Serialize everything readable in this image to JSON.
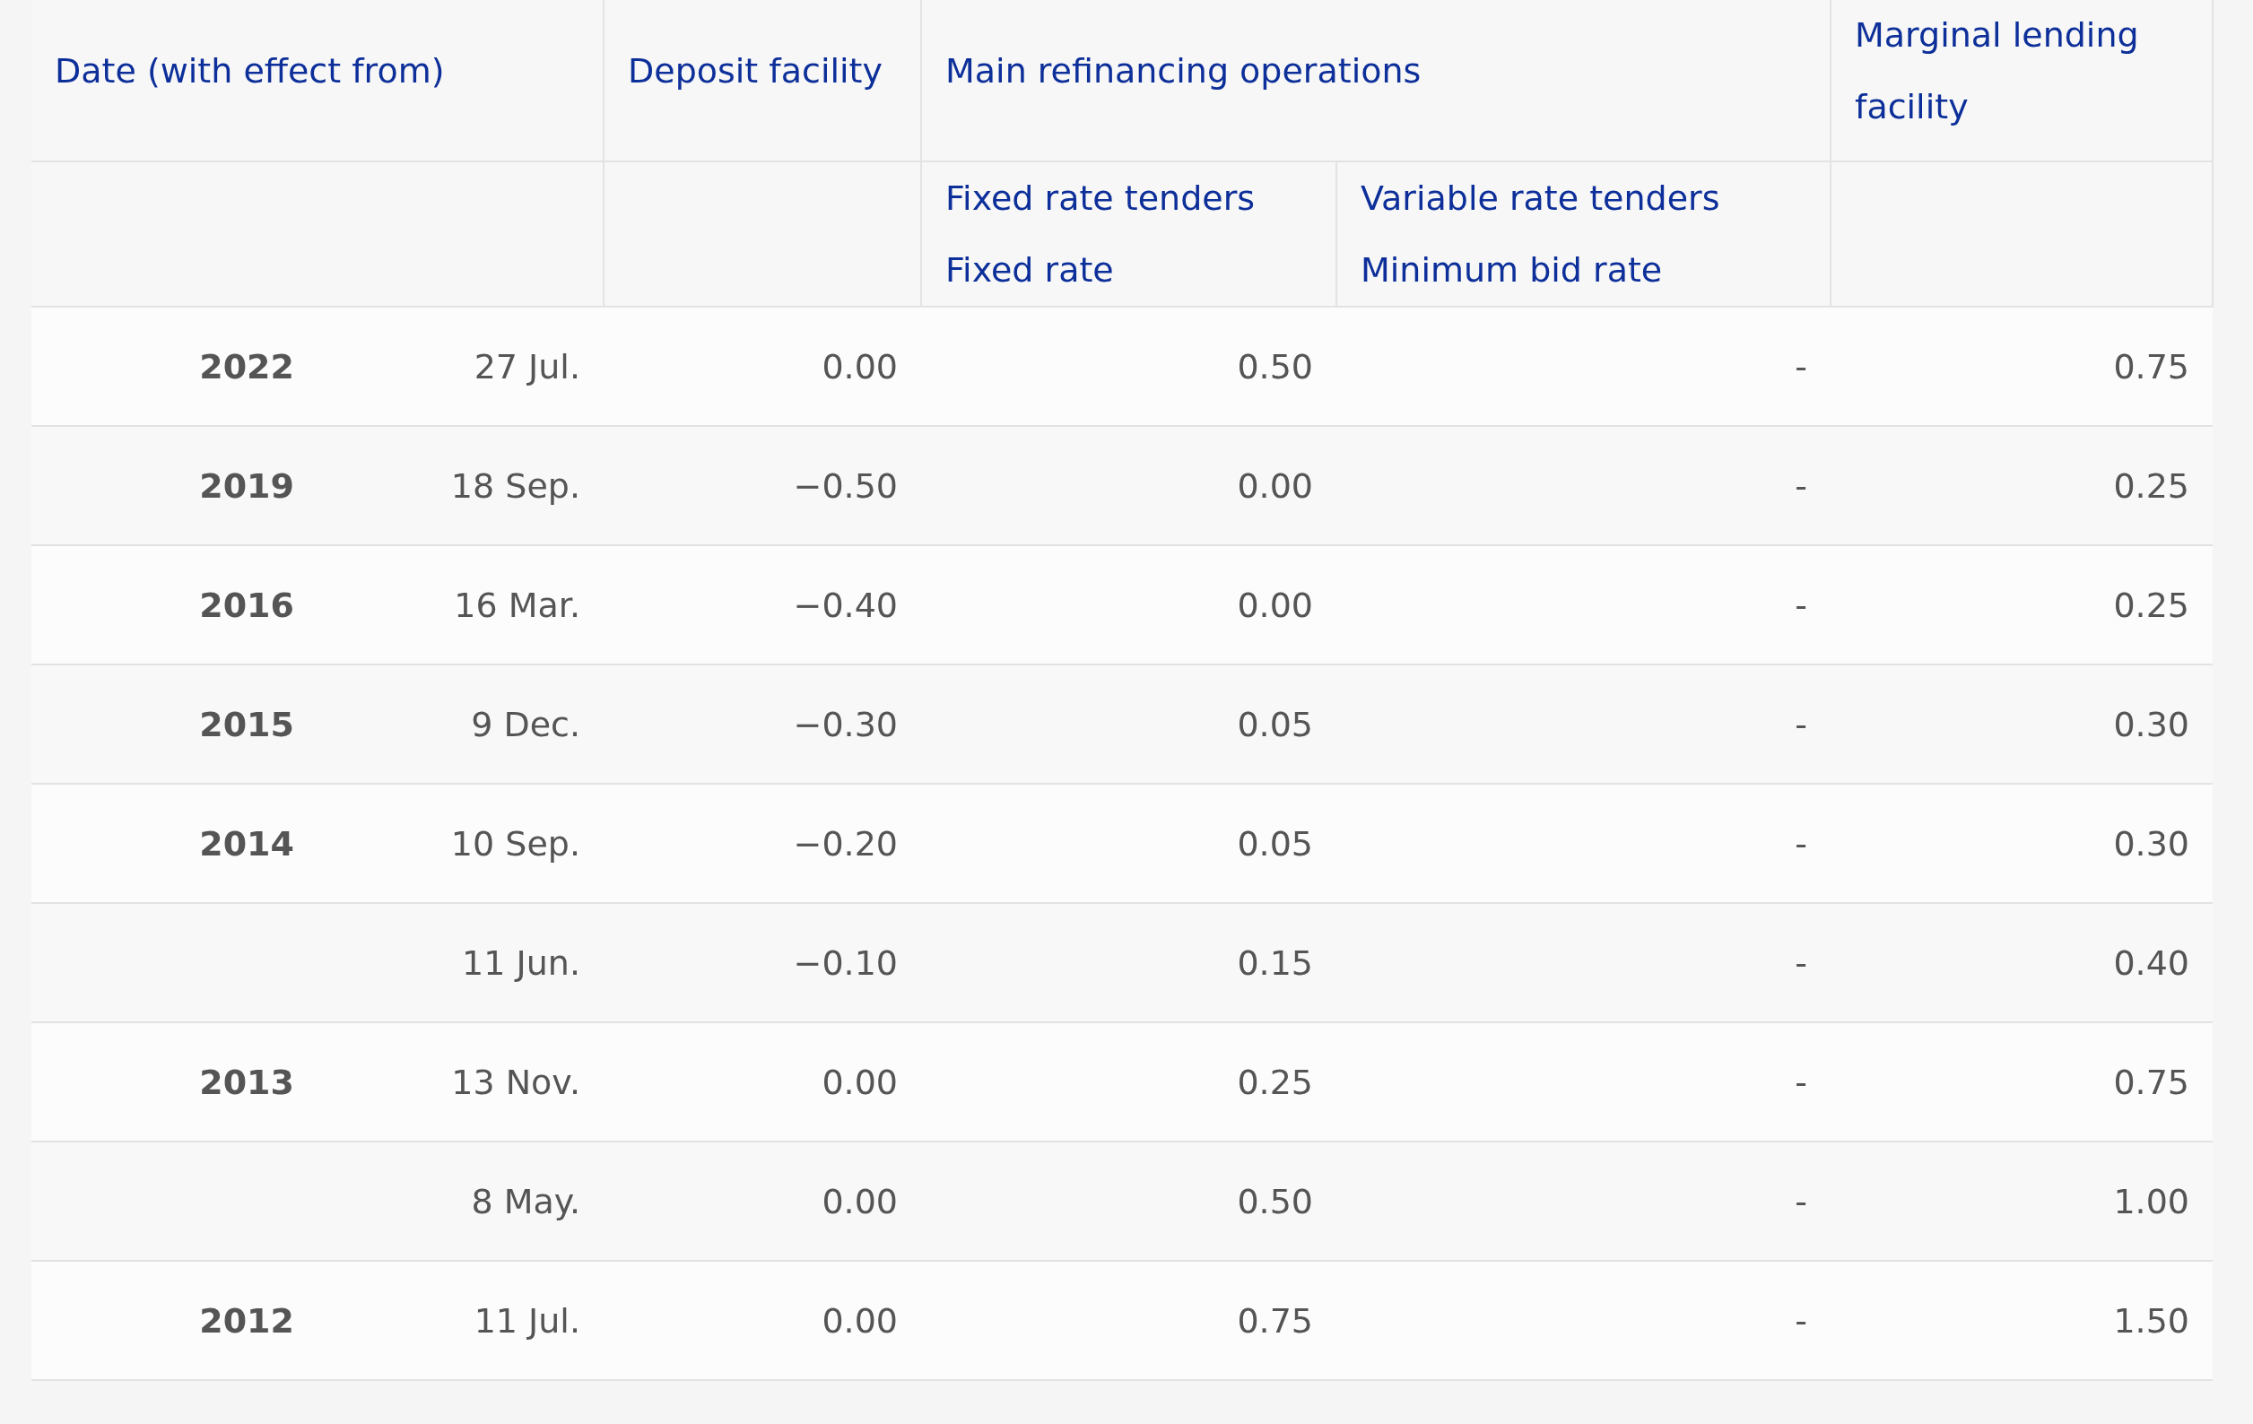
{
  "header": {
    "date": "Date (with effect from)",
    "deposit": "Deposit facility",
    "main_refinancing": "Main refinancing operations",
    "marginal": "Marginal lending facility",
    "fixed_rate_tenders": [
      "Fixed rate tenders",
      "Fixed rate"
    ],
    "variable_rate_tenders": [
      "Variable rate tenders",
      "Minimum bid rate"
    ]
  },
  "rows": [
    {
      "year": "2022",
      "date": "27 Jul.",
      "deposit": "0.00",
      "fixed_rate": "0.50",
      "minimum_bid_rate": "-",
      "marginal": "0.75"
    },
    {
      "year": "2019",
      "date": "18 Sep.",
      "deposit": "−0.50",
      "fixed_rate": "0.00",
      "minimum_bid_rate": "-",
      "marginal": "0.25"
    },
    {
      "year": "2016",
      "date": "16 Mar.",
      "deposit": "−0.40",
      "fixed_rate": "0.00",
      "minimum_bid_rate": "-",
      "marginal": "0.25"
    },
    {
      "year": "2015",
      "date": "9 Dec.",
      "deposit": "−0.30",
      "fixed_rate": "0.05",
      "minimum_bid_rate": "-",
      "marginal": "0.30"
    },
    {
      "year": "2014",
      "date": "10 Sep.",
      "deposit": "−0.20",
      "fixed_rate": "0.05",
      "minimum_bid_rate": "-",
      "marginal": "0.30"
    },
    {
      "date": "11 Jun.",
      "deposit": "−0.10",
      "fixed_rate": "0.15",
      "minimum_bid_rate": "-",
      "marginal": "0.40"
    },
    {
      "year": "2013",
      "date": "13 Nov.",
      "deposit": "0.00",
      "fixed_rate": "0.25",
      "minimum_bid_rate": "-",
      "marginal": "0.75"
    },
    {
      "date": "8 May.",
      "deposit": "0.00",
      "fixed_rate": "0.50",
      "minimum_bid_rate": "-",
      "marginal": "1.00"
    },
    {
      "year": "2012",
      "date": "11 Jul.",
      "deposit": "0.00",
      "fixed_rate": "0.75",
      "minimum_bid_rate": "-",
      "marginal": "1.50"
    }
  ]
}
